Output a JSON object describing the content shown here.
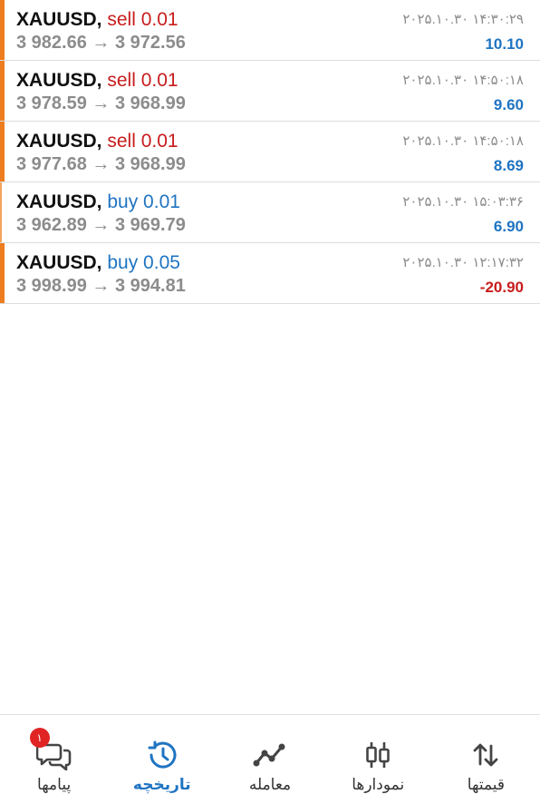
{
  "colors": {
    "sell": "#c81c1c",
    "buy": "#1f74c2",
    "accent_stripe": "#ee7d1f",
    "muted": "#8c8c8c"
  },
  "trades": [
    {
      "symbol": "XAUUSD,",
      "side": "sell",
      "volume": "sell 0.01",
      "prices": "3 982.66 → 3 972.56",
      "time": "۲۰۲۵.۱۰.۳۰ ۱۴:۳۰:۲۹",
      "profit": "10.10"
    },
    {
      "symbol": "XAUUSD,",
      "side": "sell",
      "volume": "sell 0.01",
      "prices": "3 978.59 → 3 968.99",
      "time": "۲۰۲۵.۱۰.۳۰ ۱۴:۵۰:۱۸",
      "profit": "9.60"
    },
    {
      "symbol": "XAUUSD,",
      "side": "sell",
      "volume": "sell 0.01",
      "prices": "3 977.68 → 3 968.99",
      "time": "۲۰۲۵.۱۰.۳۰ ۱۴:۵۰:۱۸",
      "profit": "8.69"
    },
    {
      "symbol": "XAUUSD,",
      "side": "buy",
      "volume": "buy 0.01",
      "prices": "3 962.89 → 3 969.79",
      "time": "۲۰۲۵.۱۰.۳۰ ۱۵:۰۳:۳۶",
      "profit": "6.90"
    },
    {
      "symbol": "XAUUSD,",
      "side": "buy",
      "volume": "buy 0.05",
      "prices": "3 998.99 → 3 994.81",
      "time": "۲۰۲۵.۱۰.۳۰ ۱۲:۱۷:۳۲",
      "profit": "-20.90"
    }
  ],
  "tabs": [
    {
      "label": "پیامها",
      "icon": "messages-icon",
      "badge": "۱"
    },
    {
      "label": "تاریخچه",
      "icon": "history-icon",
      "active": true
    },
    {
      "label": "معامله",
      "icon": "trade-icon"
    },
    {
      "label": "نمودارها",
      "icon": "chart-candles-icon"
    },
    {
      "label": "قیمتها",
      "icon": "quotes-arrows-icon"
    }
  ]
}
